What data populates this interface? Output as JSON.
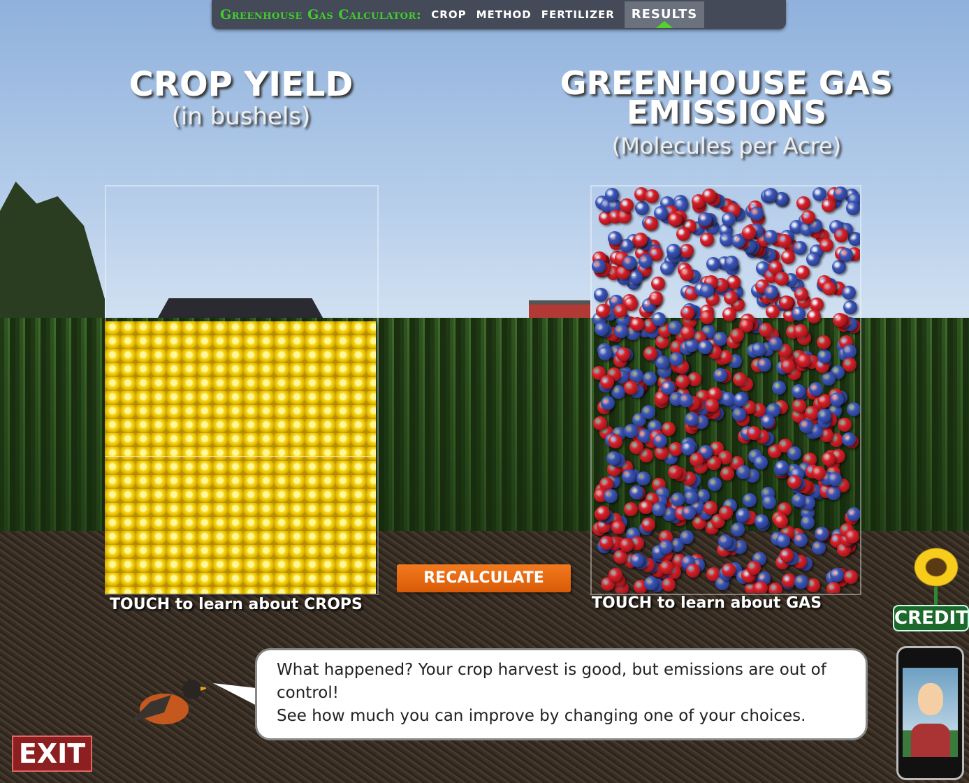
{
  "nav": {
    "title": "Greenhouse Gas Calculator:",
    "tabs": [
      {
        "label": "CROP",
        "active": false
      },
      {
        "label": "METHOD",
        "active": false
      },
      {
        "label": "FERTILIZER",
        "active": false
      },
      {
        "label": "RESULTS",
        "active": true
      }
    ]
  },
  "crop": {
    "title": "CROP YIELD",
    "subtitle": "(in bushels)",
    "caption": "TOUCH to learn about CROPS",
    "fill_fraction": 0.67
  },
  "gas": {
    "title_line1": "GREENHOUSE GAS",
    "title_line2": "EMISSIONS",
    "subtitle": "(Molecules per Acre)",
    "caption": "TOUCH to learn about GAS",
    "fill_fraction": 1.0,
    "colors": {
      "red": "#d8202a",
      "blue": "#3b55b8"
    }
  },
  "recalculate_label": "RECALCULATE",
  "message": {
    "line1": "What happened? Your crop harvest is good, but emissions are out of control!",
    "line2": "See how much you can improve by changing one of your choices."
  },
  "exit_label": "EXIT",
  "credits_label": "CREDITS"
}
